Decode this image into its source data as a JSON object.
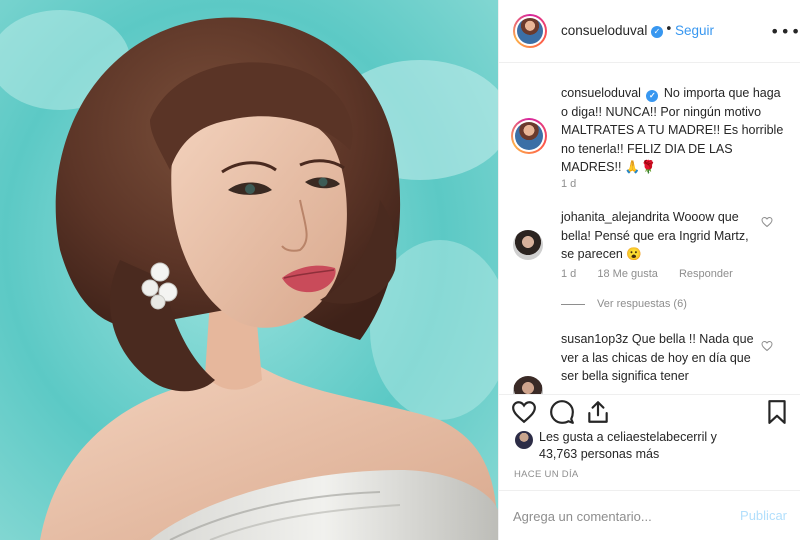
{
  "post": {
    "image_alt": "Vintage hand-tinted portrait of a woman with brown wavy hair against a turquoise background"
  },
  "header": {
    "username": "consueloduval",
    "verified_icon": "verified-badge-icon",
    "separator": "•",
    "follow_label": "Seguir",
    "more_icon": "ellipsis-icon",
    "more_label": "•••"
  },
  "caption": {
    "username": "consueloduval",
    "text": "No importa que haga o diga!! NUNCA!! Por ningún motivo MALTRATES A TU MADRE!! Es horrible no tenerla!! FELIZ DIA DE LAS MADRES!!",
    "emoji": "🙏🌹",
    "time": "1 d"
  },
  "comments": [
    {
      "username": "johanita_alejandrita",
      "text": "Wooow que bella! Pensé que era Ingrid Martz, se parecen",
      "emoji": "😮",
      "time": "1 d",
      "likes": "18 Me gusta",
      "reply_label": "Responder",
      "view_replies": "Ver respuestas (6)"
    },
    {
      "username": "susan1op3z",
      "text": "Que bella !! Nada que ver a las chicas de hoy en día que ser bella significa tener"
    }
  ],
  "actions": {
    "like_icon": "heart-icon",
    "comment_icon": "comment-bubble-icon",
    "share_icon": "share-icon",
    "save_icon": "bookmark-icon"
  },
  "likes": {
    "line1": "Les gusta a celiaestelabecerril y",
    "line2": "43,763 personas más"
  },
  "timeago": "HACE UN DÍA",
  "add_comment": {
    "placeholder": "Agrega un comentario...",
    "publish_label": "Publicar"
  },
  "colors": {
    "accent": "#3897f0",
    "muted": "#8e8e8e",
    "publish_disabled": "#b2dffc",
    "photo_background": "#58c8c4"
  }
}
